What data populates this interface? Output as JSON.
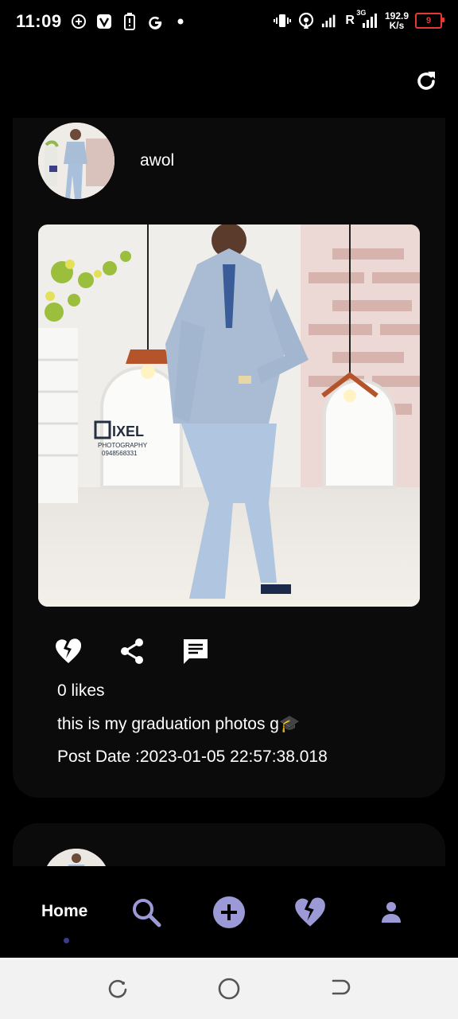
{
  "status_bar": {
    "time": "11:09",
    "network_type": "3G",
    "roaming": "R",
    "speed_value": "192.9",
    "speed_unit": "K/s",
    "battery": "9",
    "icons": [
      "chat-plus-icon",
      "v-app-icon",
      "battery-saver-icon",
      "google-icon",
      "dot-icon",
      "vibrate-icon",
      "hotspot-icon",
      "signal-icon"
    ]
  },
  "header": {
    "refresh_icon": "refresh-icon"
  },
  "post": {
    "username": "awol",
    "likes": "0 likes",
    "caption": "this is my graduation photos g🎓",
    "post_date": "Post Date :2023-01-05 22:57:38.018",
    "photo_watermark": {
      "brand": "PIXEL",
      "sub": "PHOTOGRAPHY",
      "phone": "0948568331"
    },
    "actions": [
      "broken-heart-icon",
      "share-icon",
      "comment-icon"
    ]
  },
  "bottom_nav": {
    "home_label": "Home",
    "items": [
      "search-icon",
      "add-post-icon",
      "broken-heart-icon",
      "profile-icon"
    ],
    "accent": "#9b99d6"
  },
  "system_nav": [
    "recents-icon",
    "home-circle-icon",
    "back-icon"
  ]
}
